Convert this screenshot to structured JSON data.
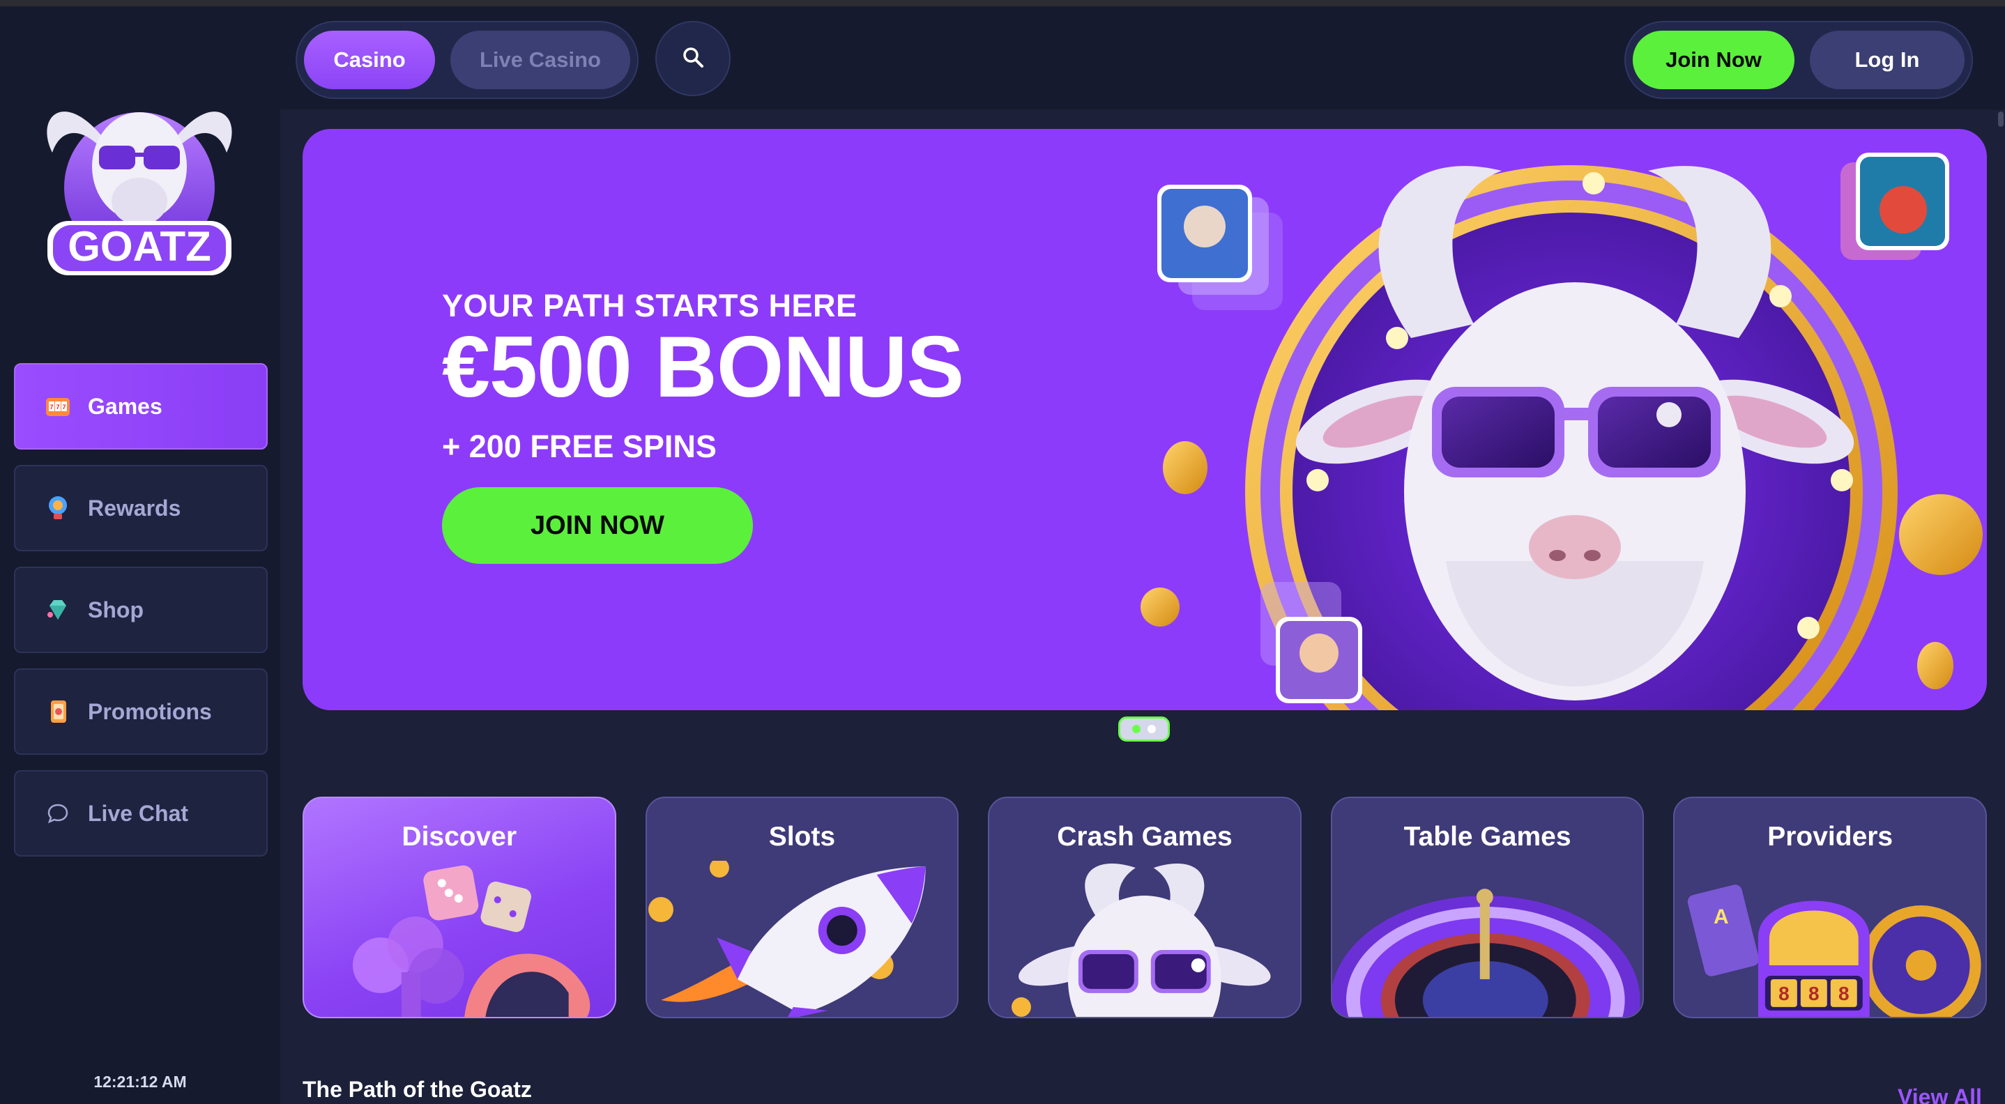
{
  "app": {
    "brand": "GOATZ"
  },
  "header": {
    "tabs": [
      {
        "label": "Casino",
        "active": true
      },
      {
        "label": "Live Casino",
        "active": false
      }
    ],
    "search_icon": "search-icon",
    "join_label": "Join Now",
    "login_label": "Log In"
  },
  "sidebar": {
    "items": [
      {
        "label": "Games",
        "icon": "slot-machine-icon",
        "active": true
      },
      {
        "label": "Rewards",
        "icon": "trophy-icon",
        "active": false
      },
      {
        "label": "Shop",
        "icon": "gem-icon",
        "active": false
      },
      {
        "label": "Promotions",
        "icon": "promo-card-icon",
        "active": false
      },
      {
        "label": "Live Chat",
        "icon": "chat-bubble-icon",
        "active": false
      }
    ],
    "clock": "12:21:12 AM"
  },
  "hero": {
    "eyebrow": "YOUR PATH STARTS HERE",
    "headline": "€500 BONUS",
    "sub": "+ 200 FREE SPINS",
    "cta": "JOIN NOW",
    "slide_count": 2,
    "active_slide": 1
  },
  "categories": [
    {
      "title": "Discover",
      "art": "dice-and-card-suits"
    },
    {
      "title": "Slots",
      "art": "rocket"
    },
    {
      "title": "Crash Games",
      "art": "goat-with-sunglasses"
    },
    {
      "title": "Table Games",
      "art": "roulette-wheel"
    },
    {
      "title": "Providers",
      "art": "slot-machine-888"
    }
  ],
  "section": {
    "title": "The Path of the Goatz",
    "view_all": "View All"
  },
  "colors": {
    "accent_purple": "#8d3bfa",
    "accent_green": "#5bf03c",
    "sidebar_bg": "#161a2e",
    "main_bg": "#1c2038"
  }
}
